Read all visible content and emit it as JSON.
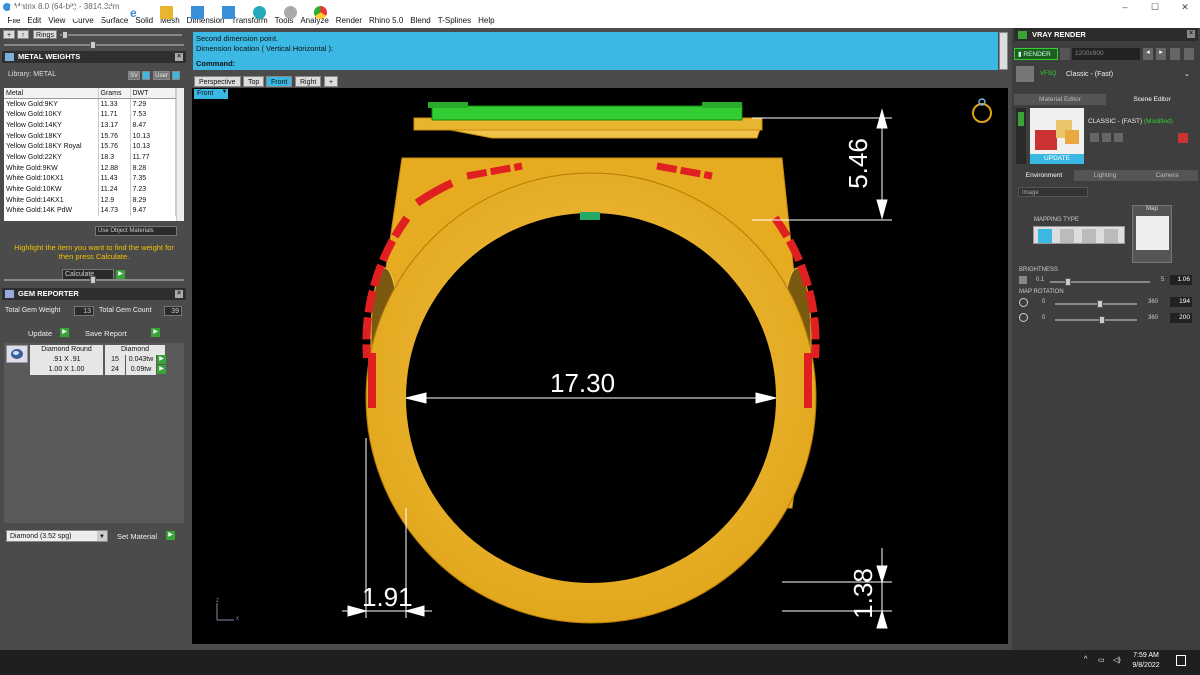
{
  "window": {
    "title": "Matrix 8.0 (64-bit) - 3814.3dm",
    "min": "–",
    "max": "☐",
    "close": "✕"
  },
  "menu": [
    "File",
    "Edit",
    "View",
    "Curve",
    "Surface",
    "Solid",
    "Mesh",
    "Dimension",
    "Transform",
    "Tools",
    "Analyze",
    "Render",
    "Rhino 5.0",
    "Blend",
    "T-Splines",
    "Help"
  ],
  "left_toolbar": {
    "ring_label": "Rings"
  },
  "metal_weights": {
    "title": "METAL WEIGHTS",
    "library_label": "Library: METAL",
    "btn_sv": "SV",
    "btn_user": "User",
    "columns": [
      "Metal",
      "Grams",
      "DWT"
    ],
    "rows": [
      [
        "Yellow Gold:9KY",
        "11.33",
        "7.29"
      ],
      [
        "Yellow Gold:10KY",
        "11.71",
        "7.53"
      ],
      [
        "Yellow Gold:14KY",
        "13.17",
        "8.47"
      ],
      [
        "Yellow Gold:18KY",
        "15.76",
        "10.13"
      ],
      [
        "Yellow Gold:18KY Royal",
        "15.76",
        "10.13"
      ],
      [
        "Yellow Gold:22KY",
        "18.3",
        "11.77"
      ],
      [
        "White Gold:9KW",
        "12.88",
        "8.28"
      ],
      [
        "White Gold:10KX1",
        "11.43",
        "7.35"
      ],
      [
        "White Gold:10KW",
        "11.24",
        "7.23"
      ],
      [
        "White Gold:14KX1",
        "12.9",
        "8.29"
      ],
      [
        "White Gold:14K PdW",
        "14.73",
        "9.47"
      ]
    ],
    "use_object_materials": "Use Object Materials",
    "hint": "Highlight the item you want to find the weight for then press Calculate.",
    "calculate": "Calculate"
  },
  "gem_reporter": {
    "title": "GEM REPORTER",
    "total_weight_label": "Total Gem Weight",
    "total_weight": "13",
    "total_count_label": "Total Gem Count",
    "total_count": "39",
    "update": "Update",
    "save_report": "Save Report",
    "header_shape": "Diamond Round",
    "header_material": "Diamond",
    "rows": [
      [
        ".91 X .91",
        "15",
        "0.043tw"
      ],
      [
        "1.00 X 1.00",
        "24",
        "0.09tw"
      ]
    ],
    "material_select": "Diamond     (3.52 spg)",
    "set_material": "Set Material"
  },
  "command": {
    "line1": "Second dimension point.",
    "line2": "Dimension location ( Vertical  Horizontal ):",
    "prompt": "Command:"
  },
  "viewport_tabs": [
    "Perspective",
    "Top",
    "Front",
    "Right",
    "+"
  ],
  "viewport_label": "Front",
  "dimensions": {
    "inner": "17.30",
    "top": "5.46",
    "bottom_left": "1.91",
    "bottom_right": "1.38"
  },
  "axis": {
    "z": "z",
    "x": "x"
  },
  "vray": {
    "title": "VRAY RENDER",
    "render": "RENDER",
    "resolution": "1200x900",
    "preset_tag": "VFSQ",
    "preset": "Classic - (Fast)",
    "tabs": [
      "Material Editor",
      "Scene Editor"
    ],
    "scene_name": "CLASSIC - (FAST)",
    "scene_status": "(Modified)",
    "update": "UPDATE",
    "env_tabs": [
      "Environment",
      "Lighting",
      "Camera"
    ],
    "env_type": "Image",
    "mapping_type": "MAPPING TYPE",
    "map_label": "Map",
    "brightness_label": "BRIGHTNESS",
    "brightness_min": "0.1",
    "brightness_max": "5",
    "brightness": "1.06",
    "rotation_label": "MAP ROTATION",
    "rot1_min": "0",
    "rot1_max": "360",
    "rot1": "194",
    "rot2_min": "0",
    "rot2_max": "360",
    "rot2": "200"
  },
  "taskbar": {
    "time": "7:59 AM",
    "date": "9/8/2022"
  }
}
